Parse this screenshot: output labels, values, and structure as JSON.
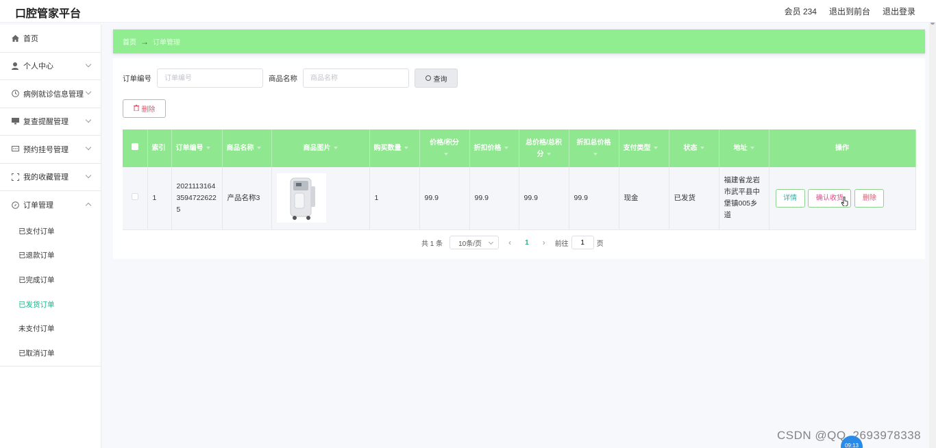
{
  "header": {
    "brand": "口腔管家平台",
    "member": "会员 234",
    "back_to_front": "退出到前台",
    "logout": "退出登录"
  },
  "sidebar": {
    "items": [
      {
        "label": "首页",
        "icon": "home-icon"
      },
      {
        "label": "个人中心",
        "icon": "user-icon"
      },
      {
        "label": "病例就诊信息管理",
        "icon": "clock-icon"
      },
      {
        "label": "复查提醒管理",
        "icon": "monitor-icon"
      },
      {
        "label": "预约挂号管理",
        "icon": "chat-icon"
      },
      {
        "label": "我的收藏管理",
        "icon": "frame-icon"
      },
      {
        "label": "订单管理",
        "icon": "compass-icon"
      }
    ],
    "submenu": [
      {
        "label": "已支付订单"
      },
      {
        "label": "已退款订单"
      },
      {
        "label": "已完成订单"
      },
      {
        "label": "已发货订单"
      },
      {
        "label": "未支付订单"
      },
      {
        "label": "已取消订单"
      }
    ]
  },
  "breadcrumb": {
    "home": "首页",
    "arrow": "→",
    "current": "订单管理"
  },
  "search": {
    "order_label": "订单编号",
    "order_placeholder": "订单编号",
    "product_label": "商品名称",
    "product_placeholder": "商品名称",
    "query_button": "查询"
  },
  "actions": {
    "delete_button": "删除"
  },
  "table": {
    "headers": [
      "索引",
      "订单编号",
      "商品名称",
      "商品图片",
      "购买数量",
      "价格/积分",
      "折扣价格",
      "总价格/总积分",
      "折扣总价格",
      "支付类型",
      "状态",
      "地址",
      "操作"
    ],
    "rows": [
      {
        "index": "1",
        "order_no": "202111316435947226225",
        "product": "产品名称3",
        "quantity": "1",
        "price": "99.9",
        "discount_price": "99.9",
        "total": "99.9",
        "discount_total": "99.9",
        "pay_type": "现金",
        "status": "已发货",
        "address": "福建省龙岩市武平县中堡镇005乡道",
        "op_detail": "详情",
        "op_confirm": "确认收货",
        "op_delete": "删除"
      }
    ]
  },
  "pager": {
    "total": "共 1 条",
    "page_size": "10条/页",
    "prev": "‹",
    "current_page": "1",
    "next": "›",
    "goto_label": "前往",
    "goto_value": "1",
    "page_unit": "页"
  },
  "watermark": "CSDN @QQ_2693978338",
  "clock": "09:13",
  "colors": {
    "accent_green": "#90ee90",
    "active_menu": "#1bb28c",
    "danger": "#e0546a"
  }
}
